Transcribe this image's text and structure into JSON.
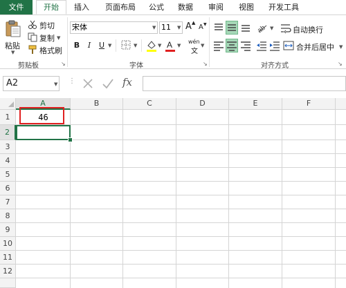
{
  "tabs": {
    "file": "文件",
    "items": [
      "开始",
      "插入",
      "页面布局",
      "公式",
      "数据",
      "审阅",
      "视图",
      "开发工具"
    ]
  },
  "ribbon": {
    "clipboard": {
      "paste": "粘贴",
      "cut": "剪切",
      "copy": "复制",
      "format_painter": "格式刷",
      "label": "剪贴板"
    },
    "font": {
      "font_name": "宋体",
      "font_size": "11",
      "bold": "B",
      "italic": "I",
      "underline": "U",
      "grow": "A",
      "shrink": "A",
      "wen": "wén",
      "label": "字体"
    },
    "alignment": {
      "wrap_text": "自动换行",
      "merge_center": "合并后居中",
      "label": "对齐方式"
    }
  },
  "formula_bar": {
    "name_box": "A2",
    "fx": "fx",
    "value": ""
  },
  "grid": {
    "columns": [
      "A",
      "B",
      "C",
      "D",
      "E",
      "F"
    ],
    "rows": [
      "1",
      "2",
      "3",
      "4",
      "5",
      "6",
      "7",
      "8",
      "9",
      "10",
      "11",
      "12"
    ],
    "cells": {
      "A1": "46"
    }
  },
  "colors": {
    "accent": "#217346",
    "highlight_red": "#e02020"
  }
}
